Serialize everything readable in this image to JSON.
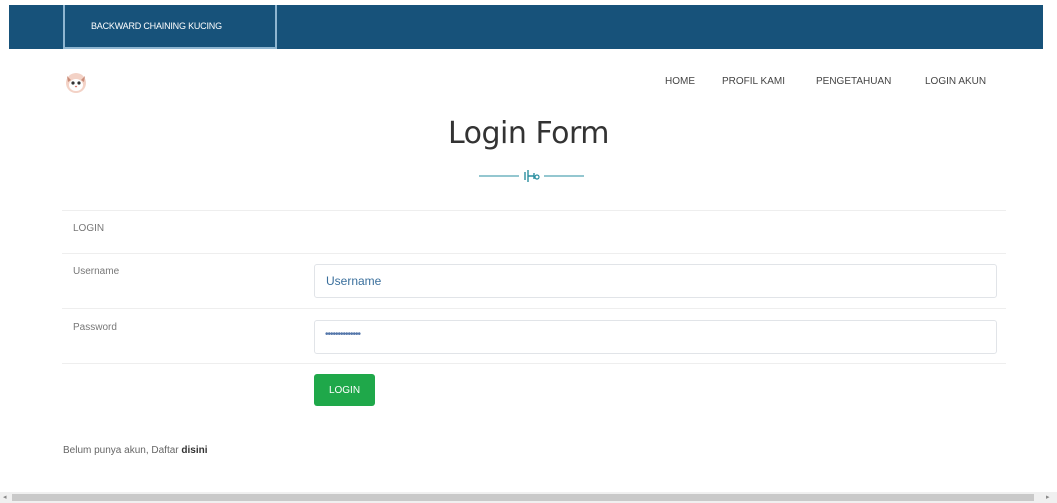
{
  "header": {
    "brand": "BACKWARD CHAINING KUCING"
  },
  "nav": {
    "home": "HOME",
    "profil": "PROFIL KAMI",
    "pengetahuan": "PENGETAHUAN",
    "login": "LOGIN AKUN"
  },
  "page": {
    "title": "Login Form"
  },
  "form": {
    "section_label": "LOGIN",
    "username_label": "Username",
    "username_placeholder": "Username",
    "password_label": "Password",
    "password_value": "••••••••••••••",
    "login_button": "LOGIN"
  },
  "signup": {
    "text": "Belum punya akun, Daftar ",
    "link": "disini"
  },
  "colors": {
    "header_bg": "#17527a",
    "button_green": "#1fa84a"
  }
}
